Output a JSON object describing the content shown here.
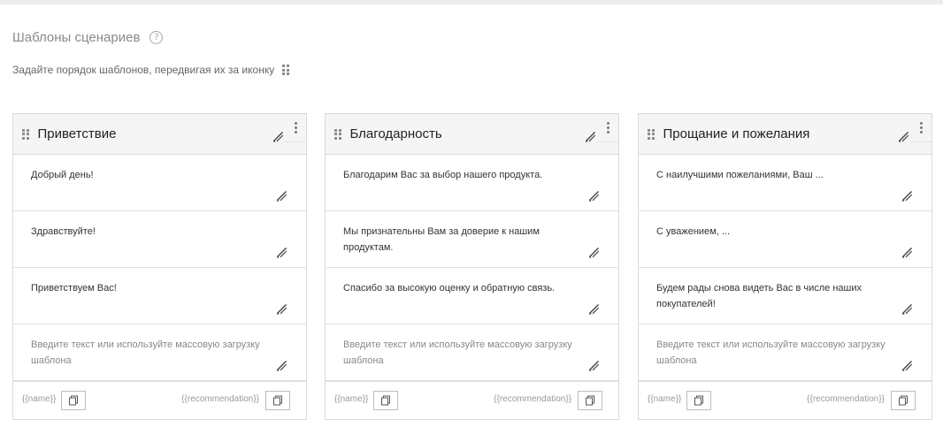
{
  "page": {
    "title": "Шаблоны сценариев",
    "help_icon": "?",
    "subtitle": "Задайте порядок шаблонов, передвигая их за иконку"
  },
  "icons": {
    "help": "question-circle-icon",
    "drag": "drag-handle-icon",
    "edit": "pencil-icon",
    "menu": "kebab-menu-icon",
    "copy": "copy-icon"
  },
  "colors": {
    "header_bg": "#f5f5f5",
    "border": "#dadada",
    "muted_text": "#8a8a8a"
  },
  "columns": [
    {
      "title": "Приветствие",
      "items": [
        "Добрый день!",
        "Здравствуйте!",
        "Приветствуем Вас!"
      ],
      "placeholder": "Введите текст или используйте массовую загрузку шаблона",
      "var_name": "{{name}}",
      "var_recommendation": "{{recommendation}}"
    },
    {
      "title": "Благодарность",
      "items": [
        "Благодарим Вас за выбор нашего продукта.",
        "Мы признательны Вам за доверие к нашим продуктам.",
        "Спасибо за высокую оценку и обратную связь."
      ],
      "placeholder": "Введите текст или используйте массовую загрузку шаблона",
      "var_name": "{{name}}",
      "var_recommendation": "{{recommendation}}"
    },
    {
      "title": "Прощание и пожелания",
      "items": [
        "С наилучшими пожеланиями, Ваш ...",
        "С уважением, ...",
        "Будем рады снова видеть Вас в числе наших покупателей!"
      ],
      "placeholder": "Введите текст или используйте массовую загрузку шаблона",
      "var_name": "{{name}}",
      "var_recommendation": "{{recommendation}}"
    }
  ]
}
